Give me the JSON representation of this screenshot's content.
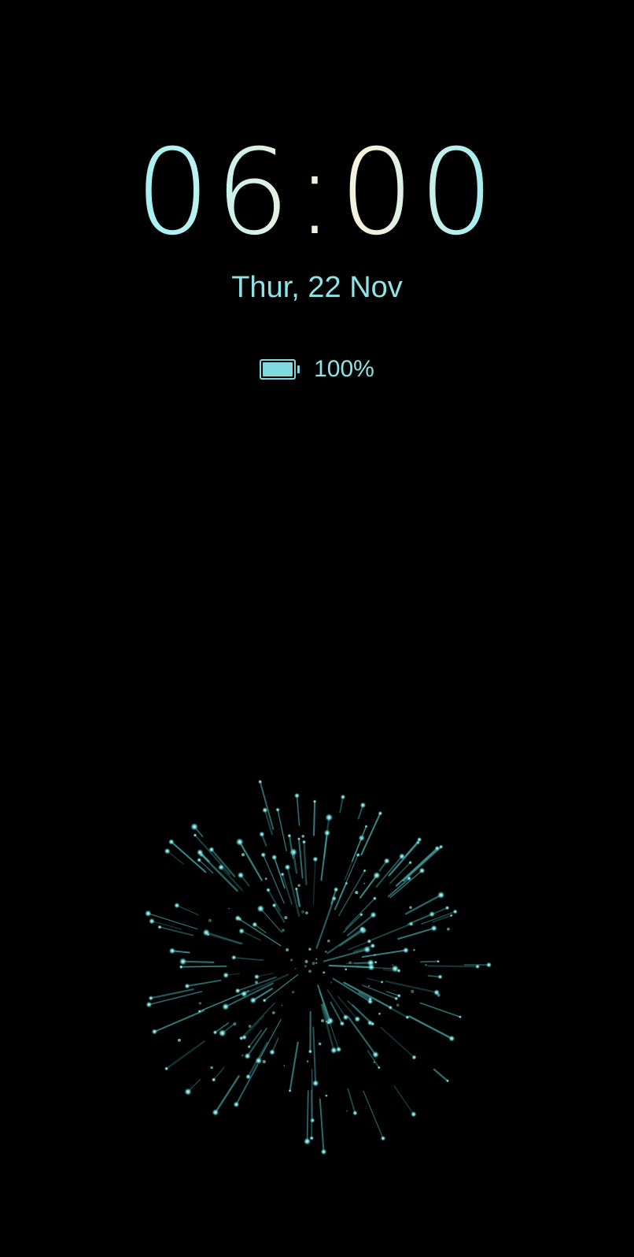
{
  "lockscreen": {
    "time": "06:00",
    "date": "Thur, 22 Nov",
    "battery": {
      "percent_text": "100%",
      "level": 1.0,
      "icon": "battery-icon",
      "color": "#7fd9de"
    },
    "animation": {
      "icon": "firework-icon",
      "color": "#6fd6d6"
    }
  }
}
